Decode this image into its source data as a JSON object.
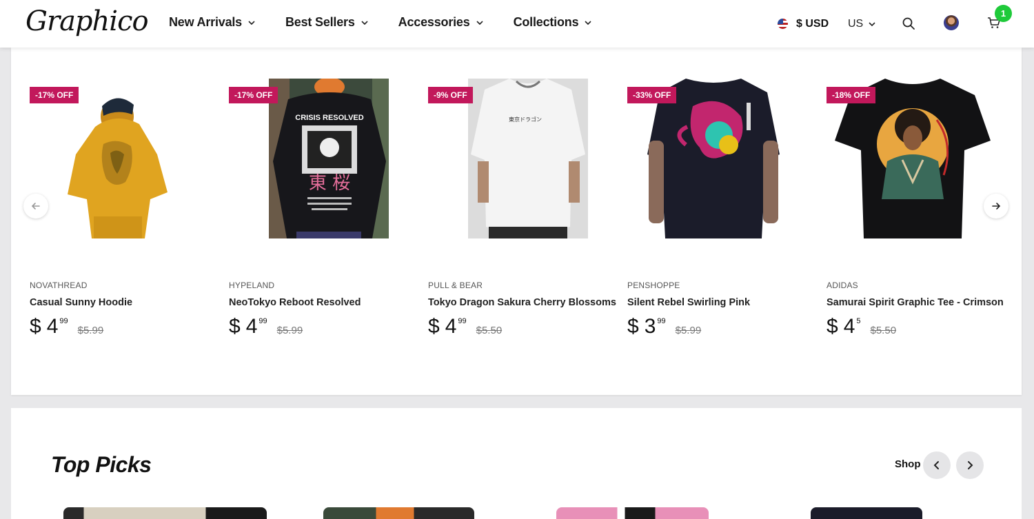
{
  "header": {
    "logo": "Graphico",
    "nav": [
      "New Arrivals",
      "Best Sellers",
      "Accessories",
      "Collections"
    ],
    "currency": "$ USD",
    "region": "US",
    "cart_count": "1"
  },
  "products": [
    {
      "badge": "-17% OFF",
      "brand": "NOVATHREAD",
      "name": "Casual Sunny Hoodie",
      "currency": "$",
      "price_int": "4",
      "price_dec": "99",
      "old_price": "$5.99"
    },
    {
      "badge": "-17% OFF",
      "brand": "HYPELAND",
      "name": "NeoTokyo Reboot Resolved",
      "currency": "$",
      "price_int": "4",
      "price_dec": "99",
      "old_price": "$5.99"
    },
    {
      "badge": "-9% OFF",
      "brand": "PULL & BEAR",
      "name": "Tokyo Dragon Sakura Cherry Blossoms",
      "currency": "$",
      "price_int": "4",
      "price_dec": "99",
      "old_price": "$5.50"
    },
    {
      "badge": "-33% OFF",
      "brand": "PENSHOPPE",
      "name": "Silent Rebel Swirling Pink",
      "currency": "$",
      "price_int": "3",
      "price_dec": "99",
      "old_price": "$5.99"
    },
    {
      "badge": "-18% OFF",
      "brand": "ADIDAS",
      "name": "Samurai Spirit Graphic Tee - Crimson",
      "currency": "$",
      "price_int": "4",
      "price_dec": "5",
      "old_price": "$5.50"
    }
  ],
  "product_images": {
    "p1_print": "CRISIS RESOLVED",
    "p1_kanji": "東 桜",
    "p2_print": "東京ドラゴン"
  },
  "top_picks": {
    "title": "Top Picks",
    "shop_label": "Shop"
  },
  "colors": {
    "badge": "#c2185b",
    "cart_badge": "#1fca3a",
    "hoodie": "#e0a420",
    "shirt_dark": "#1b1c24"
  }
}
